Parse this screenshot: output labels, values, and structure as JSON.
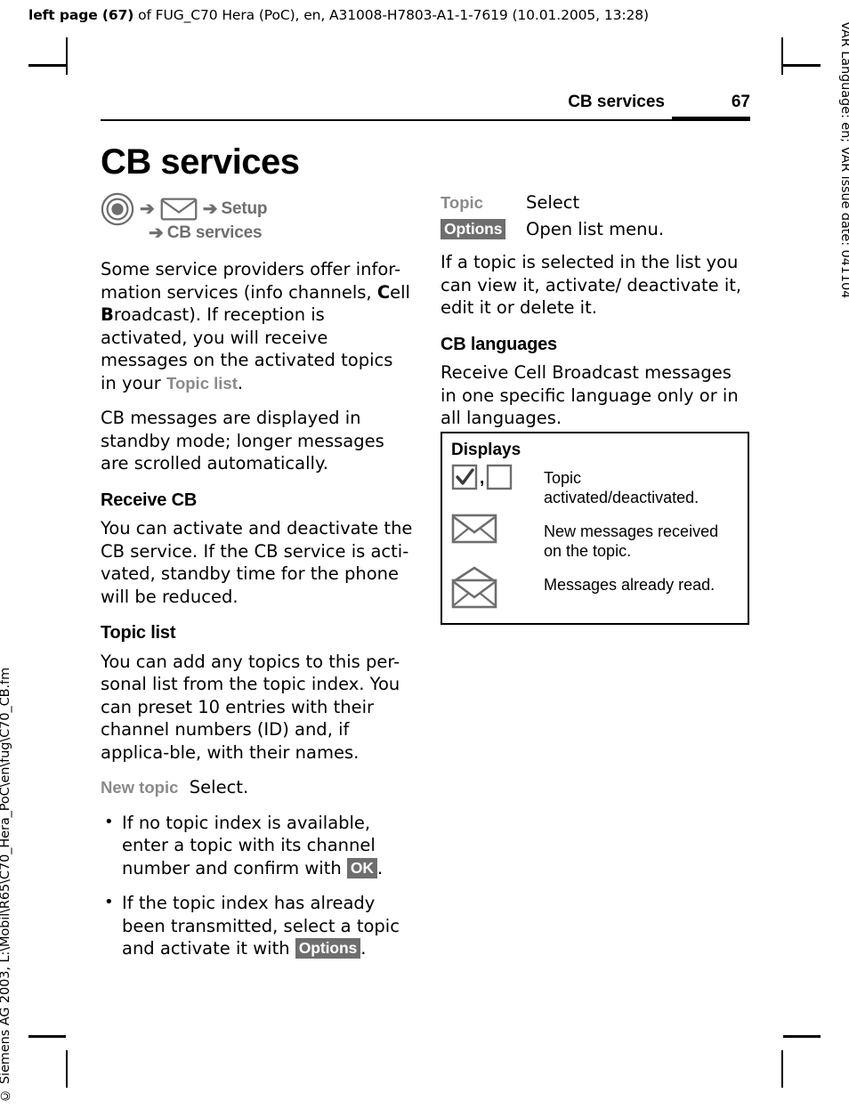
{
  "document_header": "left page (67) of FUG_C70 Hera (PoC), en, A31008-H7803-A1-1-7619 (10.01.2005, 13:28)",
  "document_header_bold": "left page (67)",
  "document_header_rest": " of FUG_C70 Hera (PoC), en, A31008-H7803-A1-1-7619 (10.01.2005, 13:28)",
  "side_text_right": "VAR Language: en; VAR issue date: 041104",
  "side_text_left": "© Siemens AG 2003, L:\\Mobil\\R65\\C70_Hera_PoC\\en\\fug\\C70_CB.fm",
  "running_head": {
    "chapter": "CB services",
    "page_number": "67"
  },
  "title": "CB services",
  "nav_path": {
    "joystick_icon": "joystick-control-icon",
    "arrow": "➔",
    "envelope_icon": "envelope-icon",
    "step_setup": "Setup",
    "step_cb_services": "CB services"
  },
  "left_column": {
    "intro_paragraph": {
      "part1": "Some service providers offer infor-mation services (info channels, ",
      "bold_c": "C",
      "part2": "ell ",
      "bold_b": "B",
      "part3": "roadcast). If reception is activated, you will receive messages on the activated topics in your ",
      "term": "Topic list",
      "part4": "."
    },
    "paragraph2": "CB messages are displayed in standby mode; longer messages are scrolled automatically.",
    "heading_receive_cb": "Receive CB",
    "receive_cb_text": "You can activate and deactivate the CB service. If the CB service is acti-vated, standby time for the phone will be reduced.",
    "heading_topic_list": "Topic list",
    "topic_list_text": "You can add any topics to this per-sonal list from the topic index. You can preset 10 entries with their channel numbers (ID) and, if applica-ble, with their names.",
    "new_topic_term": "New topic",
    "new_topic_action": "Select.",
    "bullets": [
      {
        "text_before": "If no topic index is available, enter a topic with its channel number and confirm with ",
        "softkey": "OK",
        "text_after": "."
      },
      {
        "text_before": "If the topic index has already been transmitted, select a topic and activate it with ",
        "softkey": "Options",
        "text_after": "."
      }
    ]
  },
  "right_column": {
    "definitions": [
      {
        "term": "Topic",
        "term_style": "gray",
        "description": "Select"
      },
      {
        "term": "Options",
        "term_style": "softkey",
        "description": "Open list menu."
      }
    ],
    "paragraph1": "If a topic is selected in the list you can view it, activate/ deactivate it, edit it or delete it.",
    "heading_cb_languages": "CB languages",
    "cb_languages_text": "Receive Cell Broadcast messages in one specific language only or in all languages.",
    "displays_box": {
      "title": "Displays",
      "rows": [
        {
          "icons": [
            "checkbox-checked-icon",
            "checkbox-empty-icon"
          ],
          "separator": ",",
          "description": "Topic activated/deactivated."
        },
        {
          "icons": [
            "envelope-closed-icon"
          ],
          "description": "New messages received on the topic."
        },
        {
          "icons": [
            "envelope-open-icon"
          ],
          "description": "Messages already read."
        }
      ]
    }
  },
  "colors": {
    "text": "#000000",
    "gray_term": "#8a8a8a",
    "softkey_background": "#6e6e6e",
    "softkey_text": "#ffffff",
    "icon_outline": "#6e6e6e"
  }
}
